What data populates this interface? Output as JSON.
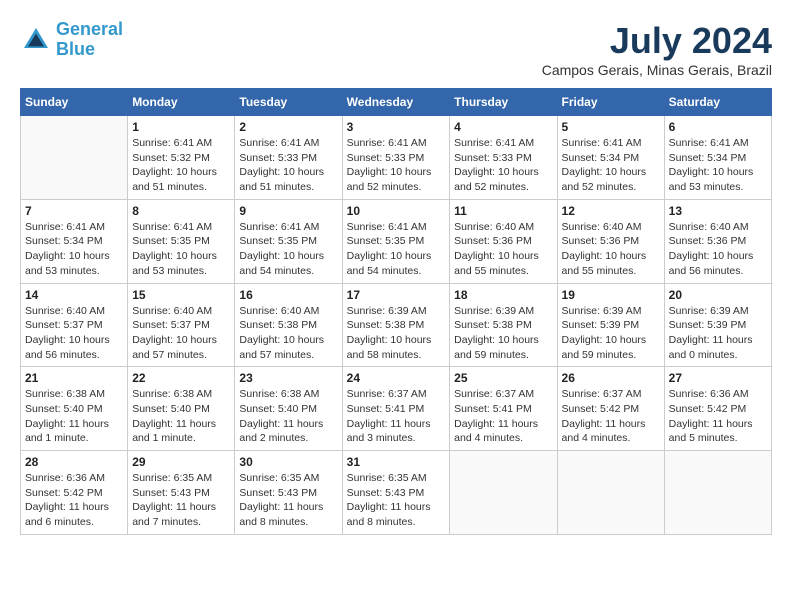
{
  "logo": {
    "line1": "General",
    "line2": "Blue"
  },
  "title": {
    "month_year": "July 2024",
    "location": "Campos Gerais, Minas Gerais, Brazil"
  },
  "headers": [
    "Sunday",
    "Monday",
    "Tuesday",
    "Wednesday",
    "Thursday",
    "Friday",
    "Saturday"
  ],
  "weeks": [
    [
      {
        "day": "",
        "info": ""
      },
      {
        "day": "1",
        "info": "Sunrise: 6:41 AM\nSunset: 5:32 PM\nDaylight: 10 hours\nand 51 minutes."
      },
      {
        "day": "2",
        "info": "Sunrise: 6:41 AM\nSunset: 5:33 PM\nDaylight: 10 hours\nand 51 minutes."
      },
      {
        "day": "3",
        "info": "Sunrise: 6:41 AM\nSunset: 5:33 PM\nDaylight: 10 hours\nand 52 minutes."
      },
      {
        "day": "4",
        "info": "Sunrise: 6:41 AM\nSunset: 5:33 PM\nDaylight: 10 hours\nand 52 minutes."
      },
      {
        "day": "5",
        "info": "Sunrise: 6:41 AM\nSunset: 5:34 PM\nDaylight: 10 hours\nand 52 minutes."
      },
      {
        "day": "6",
        "info": "Sunrise: 6:41 AM\nSunset: 5:34 PM\nDaylight: 10 hours\nand 53 minutes."
      }
    ],
    [
      {
        "day": "7",
        "info": "Sunrise: 6:41 AM\nSunset: 5:34 PM\nDaylight: 10 hours\nand 53 minutes."
      },
      {
        "day": "8",
        "info": "Sunrise: 6:41 AM\nSunset: 5:35 PM\nDaylight: 10 hours\nand 53 minutes."
      },
      {
        "day": "9",
        "info": "Sunrise: 6:41 AM\nSunset: 5:35 PM\nDaylight: 10 hours\nand 54 minutes."
      },
      {
        "day": "10",
        "info": "Sunrise: 6:41 AM\nSunset: 5:35 PM\nDaylight: 10 hours\nand 54 minutes."
      },
      {
        "day": "11",
        "info": "Sunrise: 6:40 AM\nSunset: 5:36 PM\nDaylight: 10 hours\nand 55 minutes."
      },
      {
        "day": "12",
        "info": "Sunrise: 6:40 AM\nSunset: 5:36 PM\nDaylight: 10 hours\nand 55 minutes."
      },
      {
        "day": "13",
        "info": "Sunrise: 6:40 AM\nSunset: 5:36 PM\nDaylight: 10 hours\nand 56 minutes."
      }
    ],
    [
      {
        "day": "14",
        "info": "Sunrise: 6:40 AM\nSunset: 5:37 PM\nDaylight: 10 hours\nand 56 minutes."
      },
      {
        "day": "15",
        "info": "Sunrise: 6:40 AM\nSunset: 5:37 PM\nDaylight: 10 hours\nand 57 minutes."
      },
      {
        "day": "16",
        "info": "Sunrise: 6:40 AM\nSunset: 5:38 PM\nDaylight: 10 hours\nand 57 minutes."
      },
      {
        "day": "17",
        "info": "Sunrise: 6:39 AM\nSunset: 5:38 PM\nDaylight: 10 hours\nand 58 minutes."
      },
      {
        "day": "18",
        "info": "Sunrise: 6:39 AM\nSunset: 5:38 PM\nDaylight: 10 hours\nand 59 minutes."
      },
      {
        "day": "19",
        "info": "Sunrise: 6:39 AM\nSunset: 5:39 PM\nDaylight: 10 hours\nand 59 minutes."
      },
      {
        "day": "20",
        "info": "Sunrise: 6:39 AM\nSunset: 5:39 PM\nDaylight: 11 hours\nand 0 minutes."
      }
    ],
    [
      {
        "day": "21",
        "info": "Sunrise: 6:38 AM\nSunset: 5:40 PM\nDaylight: 11 hours\nand 1 minute."
      },
      {
        "day": "22",
        "info": "Sunrise: 6:38 AM\nSunset: 5:40 PM\nDaylight: 11 hours\nand 1 minute."
      },
      {
        "day": "23",
        "info": "Sunrise: 6:38 AM\nSunset: 5:40 PM\nDaylight: 11 hours\nand 2 minutes."
      },
      {
        "day": "24",
        "info": "Sunrise: 6:37 AM\nSunset: 5:41 PM\nDaylight: 11 hours\nand 3 minutes."
      },
      {
        "day": "25",
        "info": "Sunrise: 6:37 AM\nSunset: 5:41 PM\nDaylight: 11 hours\nand 4 minutes."
      },
      {
        "day": "26",
        "info": "Sunrise: 6:37 AM\nSunset: 5:42 PM\nDaylight: 11 hours\nand 4 minutes."
      },
      {
        "day": "27",
        "info": "Sunrise: 6:36 AM\nSunset: 5:42 PM\nDaylight: 11 hours\nand 5 minutes."
      }
    ],
    [
      {
        "day": "28",
        "info": "Sunrise: 6:36 AM\nSunset: 5:42 PM\nDaylight: 11 hours\nand 6 minutes."
      },
      {
        "day": "29",
        "info": "Sunrise: 6:35 AM\nSunset: 5:43 PM\nDaylight: 11 hours\nand 7 minutes."
      },
      {
        "day": "30",
        "info": "Sunrise: 6:35 AM\nSunset: 5:43 PM\nDaylight: 11 hours\nand 8 minutes."
      },
      {
        "day": "31",
        "info": "Sunrise: 6:35 AM\nSunset: 5:43 PM\nDaylight: 11 hours\nand 8 minutes."
      },
      {
        "day": "",
        "info": ""
      },
      {
        "day": "",
        "info": ""
      },
      {
        "day": "",
        "info": ""
      }
    ]
  ]
}
